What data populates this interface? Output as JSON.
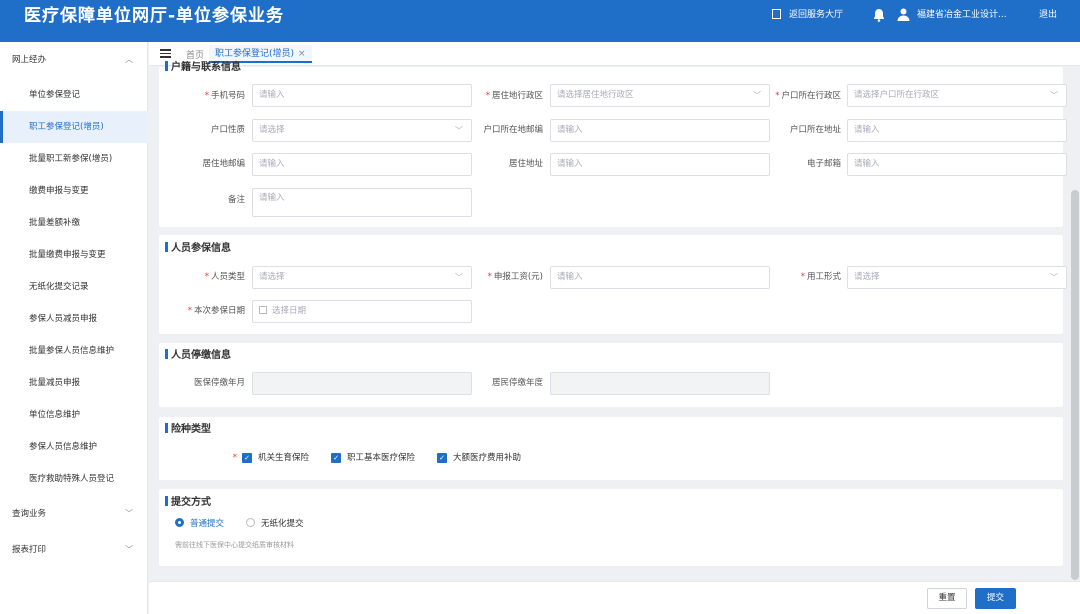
{
  "header": {
    "title": "医疗保障单位网厅-单位参保业务",
    "back_label": "返回服务大厅",
    "org_name": "福建省冶金工业设计...",
    "logout_label": "退出"
  },
  "sidebar": {
    "group_online": "网上经办",
    "items": [
      "单位参保登记",
      "职工参保登记(增员)",
      "批量职工新参保(增员)",
      "缴费申报与变更",
      "批量差额补缴",
      "批量缴费申报与变更",
      "无纸化提交记录",
      "参保人员减员申报",
      "批量参保人员信息维护",
      "批量减员申报",
      "单位信息维护",
      "参保人员信息维护",
      "医疗救助特殊人员登记"
    ],
    "group_query": "查询业务",
    "group_report": "报表打印"
  },
  "tabs": {
    "home": "首页",
    "current": "职工参保登记(增员)",
    "close": "×"
  },
  "contact": {
    "section_title": "户籍与联系信息",
    "phone_label": "手机号码",
    "phone_placeholder": "请输入",
    "residence_region_label": "居住地行政区",
    "residence_region_placeholder": "请选择居住地行政区",
    "hukou_region_label": "户口所在行政区",
    "hukou_region_placeholder": "请选择户口所在行政区",
    "hukou_type_label": "户口性质",
    "hukou_type_placeholder": "请选择",
    "hukou_postcode_label": "户口所在地邮编",
    "hukou_postcode_placeholder": "请输入",
    "hukou_address_label": "户口所在地址",
    "hukou_address_placeholder": "请输入",
    "res_postcode_label": "居住地邮编",
    "res_postcode_placeholder": "请输入",
    "res_address_label": "居住地址",
    "res_address_placeholder": "请输入",
    "email_label": "电子邮箱",
    "email_placeholder": "请输入",
    "remark_label": "备注",
    "remark_placeholder": "请输入"
  },
  "insured": {
    "section_title": "人员参保信息",
    "person_type_label": "人员类型",
    "person_type_placeholder": "请选择",
    "wage_label": "申报工资(元)",
    "wage_placeholder": "请输入",
    "employment_label": "用工形式",
    "employment_placeholder": "请选择",
    "date_label": "本次参保日期",
    "date_placeholder": "选择日期"
  },
  "stop": {
    "section_title": "人员停缴信息",
    "medical_stop_label": "医保停缴年月",
    "resident_stop_label": "居民停缴年度"
  },
  "insurance_types": {
    "section_title": "险种类型",
    "options": [
      "机关生育保险",
      "职工基本医疗保险",
      "大额医疗费用补助"
    ]
  },
  "submit_method": {
    "section_title": "提交方式",
    "normal": "普通提交",
    "paperless": "无纸化提交",
    "hint": "需前往线下医保中心提交纸质审核材料"
  },
  "footer": {
    "reset": "重置",
    "submit": "提交"
  },
  "colors": {
    "primary": "#1f6fc9",
    "required": "#e53935"
  }
}
